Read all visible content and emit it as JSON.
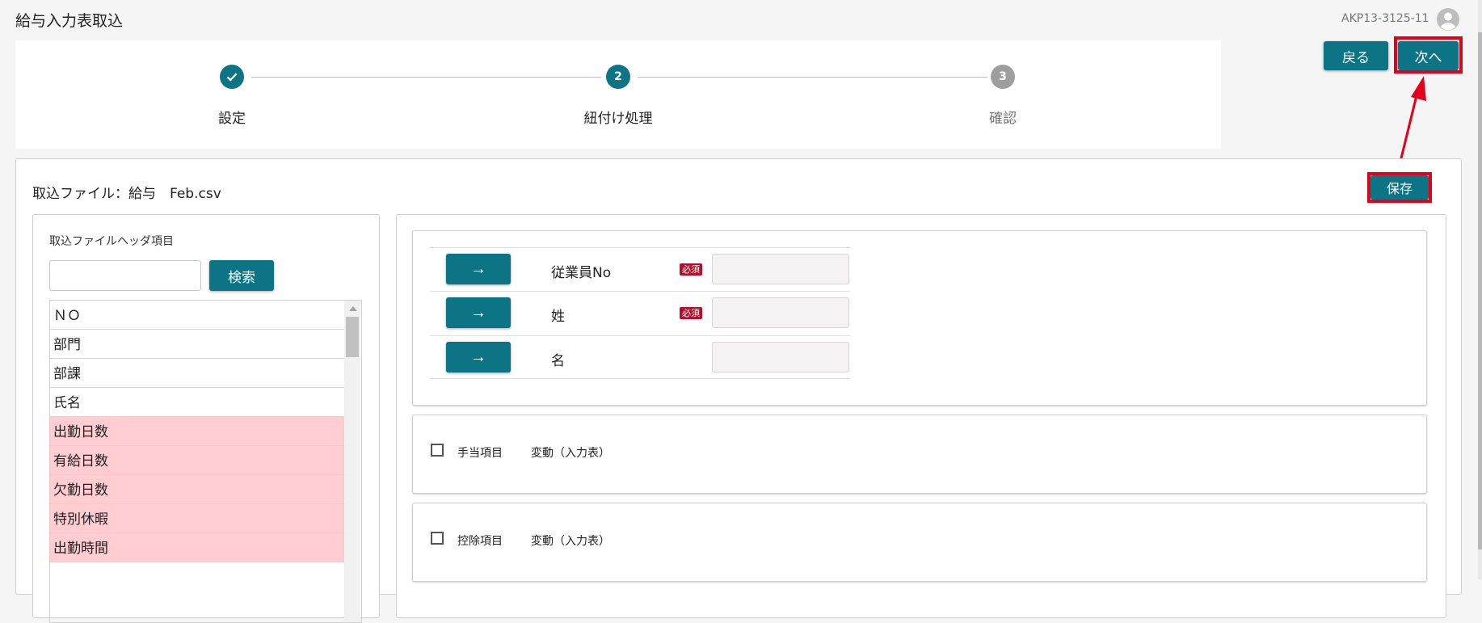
{
  "header": {
    "title": "給与入力表取込",
    "user_code": "AKP13-3125-11"
  },
  "stepper": {
    "steps": [
      {
        "number": "✓",
        "label": "設定",
        "state": "done"
      },
      {
        "number": "2",
        "label": "紐付け処理",
        "state": "active"
      },
      {
        "number": "3",
        "label": "確認",
        "state": "pending"
      }
    ]
  },
  "actions": {
    "back_label": "戻る",
    "next_label": "次へ",
    "save_label": "保存"
  },
  "file": {
    "label": "取込ファイル：給与　Feb.csv"
  },
  "header_panel": {
    "title": "取込ファイルヘッダ項目",
    "search_button": "検索",
    "search_value": "",
    "items": [
      {
        "label": "ＮＯ",
        "highlight": false
      },
      {
        "label": "部門",
        "highlight": false
      },
      {
        "label": "部課",
        "highlight": false
      },
      {
        "label": "氏名",
        "highlight": false
      },
      {
        "label": "出勤日数",
        "highlight": true
      },
      {
        "label": "有給日数",
        "highlight": true
      },
      {
        "label": "欠勤日数",
        "highlight": true
      },
      {
        "label": "特別休暇",
        "highlight": true
      },
      {
        "label": "出勤時間",
        "highlight": true
      }
    ]
  },
  "mapping": {
    "rows": [
      {
        "arrow": "→",
        "field": "従業員No",
        "required": "必須",
        "value": ""
      },
      {
        "arrow": "→",
        "field": "姓",
        "required": "必須",
        "value": ""
      },
      {
        "arrow": "→",
        "field": "名",
        "required": "",
        "value": ""
      }
    ]
  },
  "categories": [
    {
      "name": "手当項目",
      "type": "変動（入力表）"
    },
    {
      "name": "控除項目",
      "type": "変動（入力表）"
    }
  ],
  "colors": {
    "accent": "#0d7485",
    "highlight": "#ffcdd2",
    "annotation": "#e3001b",
    "required": "#b0102a"
  }
}
